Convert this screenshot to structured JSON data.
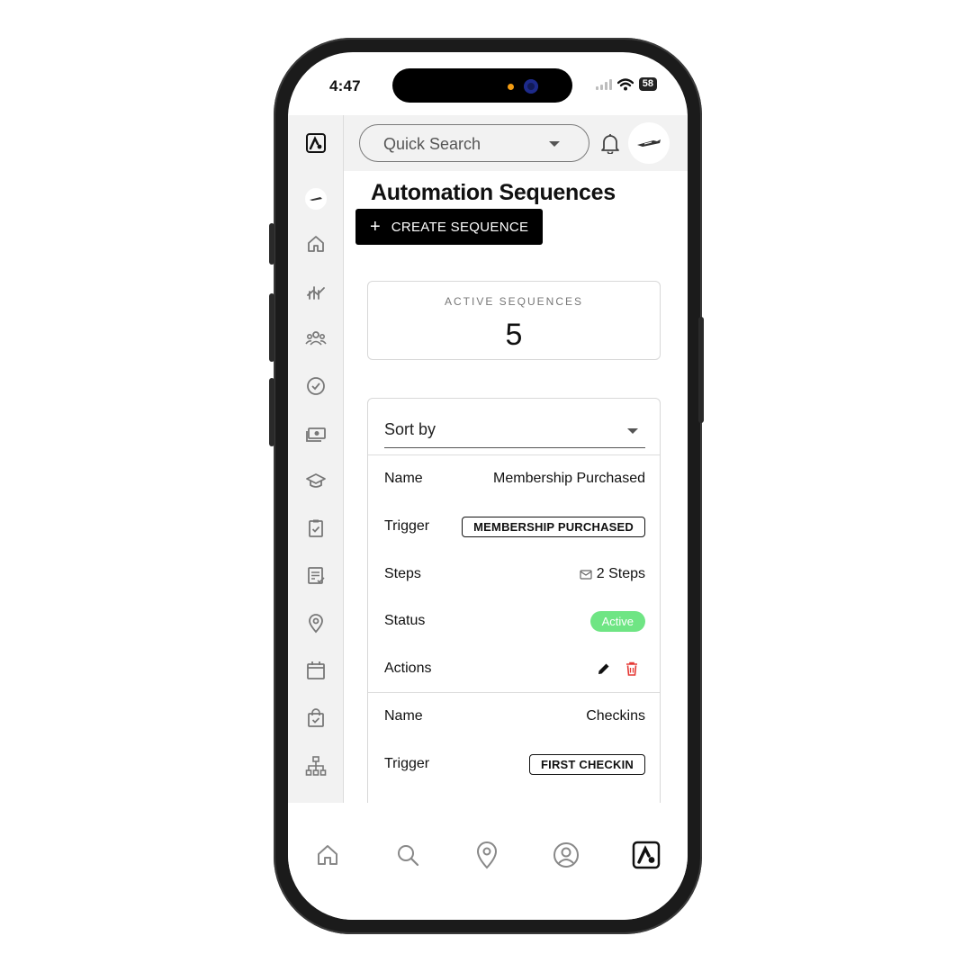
{
  "status_bar": {
    "time": "4:47",
    "battery": "58"
  },
  "topbar": {
    "search_placeholder": "Quick Search"
  },
  "page": {
    "title": "Automation Sequences",
    "create_button": "CREATE SEQUENCE",
    "create_icon": "+"
  },
  "stats": {
    "label": "ACTIVE SEQUENCES",
    "value": "5"
  },
  "list": {
    "sort_label": "Sort by",
    "field_labels": {
      "name": "Name",
      "trigger": "Trigger",
      "steps": "Steps",
      "status": "Status",
      "actions": "Actions"
    },
    "items": [
      {
        "name": "Membership Purchased",
        "trigger": "MEMBERSHIP PURCHASED",
        "steps": "2 Steps",
        "status": "Active"
      },
      {
        "name": "Checkins",
        "trigger": "FIRST CHECKIN"
      }
    ]
  },
  "sidebar": {
    "items": [
      "logo-icon",
      "avatar",
      "home-icon",
      "analytics-icon",
      "members-icon",
      "check-circle-icon",
      "payments-icon",
      "education-icon",
      "clipboard-check-icon",
      "notes-icon",
      "location-icon",
      "calendar-icon",
      "shopping-bag-icon",
      "hierarchy-icon"
    ]
  },
  "bottom_nav": {
    "items": [
      "home-icon",
      "search-icon",
      "location-icon",
      "profile-icon",
      "app-logo-icon"
    ]
  },
  "colors": {
    "status_active": "#6fe584",
    "delete": "#e53935",
    "primary_button": "#000000"
  }
}
